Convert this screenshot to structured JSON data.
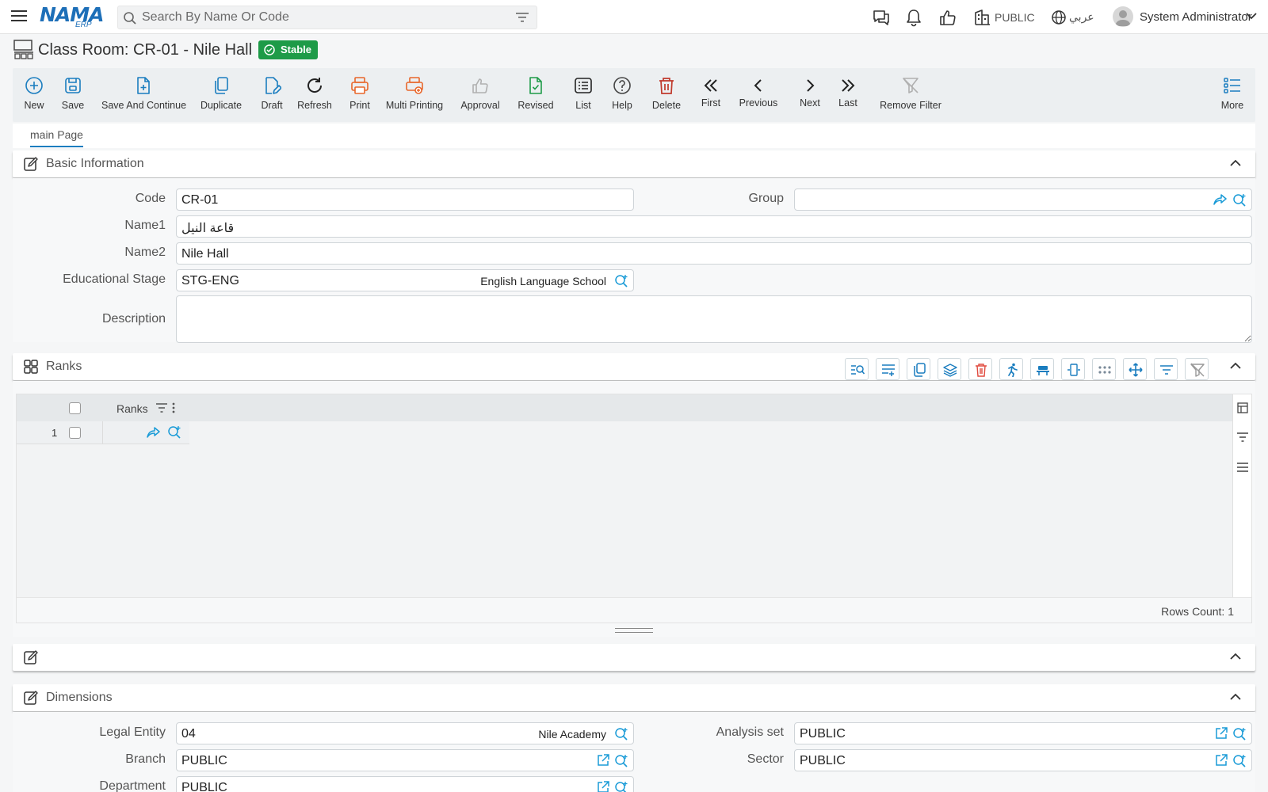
{
  "topbar": {
    "search_placeholder": "Search By Name Or Code",
    "company": "PUBLIC",
    "language": "عربي",
    "user": "System Administrator",
    "logo": "NAMA",
    "logo_sub": "ERP"
  },
  "page": {
    "title": "Class Room: CR-01 - Nile Hall",
    "status": "Stable"
  },
  "toolbar": [
    {
      "label": "New",
      "icon": "plus-circle-icon"
    },
    {
      "label": "Save",
      "icon": "save-icon"
    },
    {
      "label": "Save And Continue",
      "icon": "file-plus-icon"
    },
    {
      "label": "Duplicate",
      "icon": "duplicate-icon"
    },
    {
      "label": "Draft",
      "icon": "draft-icon"
    },
    {
      "label": "Refresh",
      "icon": "refresh-icon"
    },
    {
      "label": "Print",
      "icon": "print-icon"
    },
    {
      "label": "Multi Printing",
      "icon": "multi-print-icon"
    },
    {
      "label": "Approval",
      "icon": "thumbs-up-icon"
    },
    {
      "label": "Revised",
      "icon": "revised-icon"
    },
    {
      "label": "List",
      "icon": "list-icon"
    },
    {
      "label": "Help",
      "icon": "help-icon"
    },
    {
      "label": "Delete",
      "icon": "trash-icon"
    },
    {
      "label": "First",
      "icon": "double-chevron-left-icon"
    },
    {
      "label": "Previous",
      "icon": "chevron-left-icon"
    },
    {
      "label": "Next",
      "icon": "chevron-right-icon"
    },
    {
      "label": "Last",
      "icon": "double-chevron-right-icon"
    },
    {
      "label": "Remove Filter",
      "icon": "filter-off-icon"
    },
    {
      "label": "More",
      "icon": "more-list-icon"
    }
  ],
  "tabs": {
    "main": "main Page"
  },
  "basic_info": {
    "title": "Basic Information",
    "code_label": "Code",
    "code": "CR-01",
    "group_label": "Group",
    "group": "",
    "name1_label": "Name1",
    "name1": "قاعة النيل",
    "name2_label": "Name2",
    "name2": "Nile Hall",
    "stage_label": "Educational Stage",
    "stage_code": "STG-ENG",
    "stage_name": "English Language School",
    "description_label": "Description",
    "description": ""
  },
  "ranks": {
    "title": "Ranks",
    "column": "Ranks",
    "rows": [
      {
        "num": "1",
        "value": ""
      }
    ],
    "rows_count": "Rows Count: 1"
  },
  "untitled_section": {
    "title": ""
  },
  "dimensions": {
    "title": "Dimensions",
    "legal_entity_label": "Legal Entity",
    "legal_entity": "04",
    "legal_entity_name": "Nile Academy",
    "analysis_set_label": "Analysis set",
    "analysis_set": "PUBLIC",
    "branch_label": "Branch",
    "branch": "PUBLIC",
    "sector_label": "Sector",
    "sector": "PUBLIC",
    "department_label": "Department",
    "department": "PUBLIC"
  },
  "colors": {
    "accent": "#1a7dbf",
    "orange": "#e8662a",
    "green": "#1e9b48",
    "red": "#d9362f",
    "gray": "#b0b0b0"
  }
}
